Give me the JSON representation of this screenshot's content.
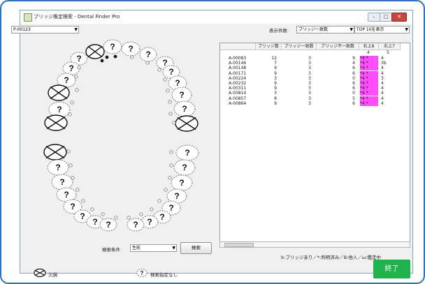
{
  "window": {
    "title": "ブリッジ推定検索 - Dental Finder Pro"
  },
  "patient": {
    "selected": "P-00123"
  },
  "top_controls": {
    "count_label": "表示件数",
    "sort_value": "ブリッジ一致数",
    "top_value": "TOP 10を表示"
  },
  "grid": {
    "headers": [
      "",
      "ブリッジ数",
      "ブリッジ一致数",
      "ブリッジ不一致数",
      "右上8",
      "右上7"
    ],
    "subheader": {
      "c5": "4",
      "c6": "5"
    },
    "rows": [
      {
        "id": "A-00083",
        "n": "12",
        "m": "3",
        "u": "9",
        "r8": "*4 *",
        "r7": "4"
      },
      {
        "id": "A-00146",
        "n": "7",
        "m": "3",
        "u": "4",
        "r8": "*4 *",
        "r7": "3b"
      },
      {
        "id": "A-00148",
        "n": "9",
        "m": "3",
        "u": "6",
        "r8": "*4 *",
        "r7": "4"
      },
      {
        "id": "A-00171",
        "n": "9",
        "m": "3",
        "u": "6",
        "r8": "*4 *",
        "r7": "4"
      },
      {
        "id": "A-00224",
        "n": "3",
        "m": "3",
        "u": "0",
        "r8": "*4 *",
        "r7": "3"
      },
      {
        "id": "A-00232",
        "n": "9",
        "m": "3",
        "u": "6",
        "r8": "*4 *",
        "r7": "4"
      },
      {
        "id": "A-00311",
        "n": "9",
        "m": "3",
        "u": "6",
        "r8": "*4 *",
        "r7": "4"
      },
      {
        "id": "A-00814",
        "n": "3",
        "m": "3",
        "u": "0",
        "r8": "*4 *",
        "r7": "4"
      },
      {
        "id": "A-00857",
        "n": "8",
        "m": "3",
        "u": "5",
        "r8": "*4 *",
        "r7": "4"
      },
      {
        "id": "A-00864",
        "n": "9",
        "m": "3",
        "u": "6",
        "r8": "*4 *",
        "r7": "4"
      }
    ]
  },
  "legend_note": "b:ブリッジあり／*:判明済み／B:他人／ω:鑑定中",
  "search": {
    "cond_label": "検索条件",
    "cond_value": "生前",
    "button": "検索"
  },
  "legend": {
    "missing": "欠損",
    "unspecified": "検索指定なし"
  },
  "end_button": "終了",
  "tooth_symbol": "?",
  "colors": {
    "pink": "#ff4dff",
    "end": "#1fb34b",
    "frame": "#2f6fbf"
  }
}
